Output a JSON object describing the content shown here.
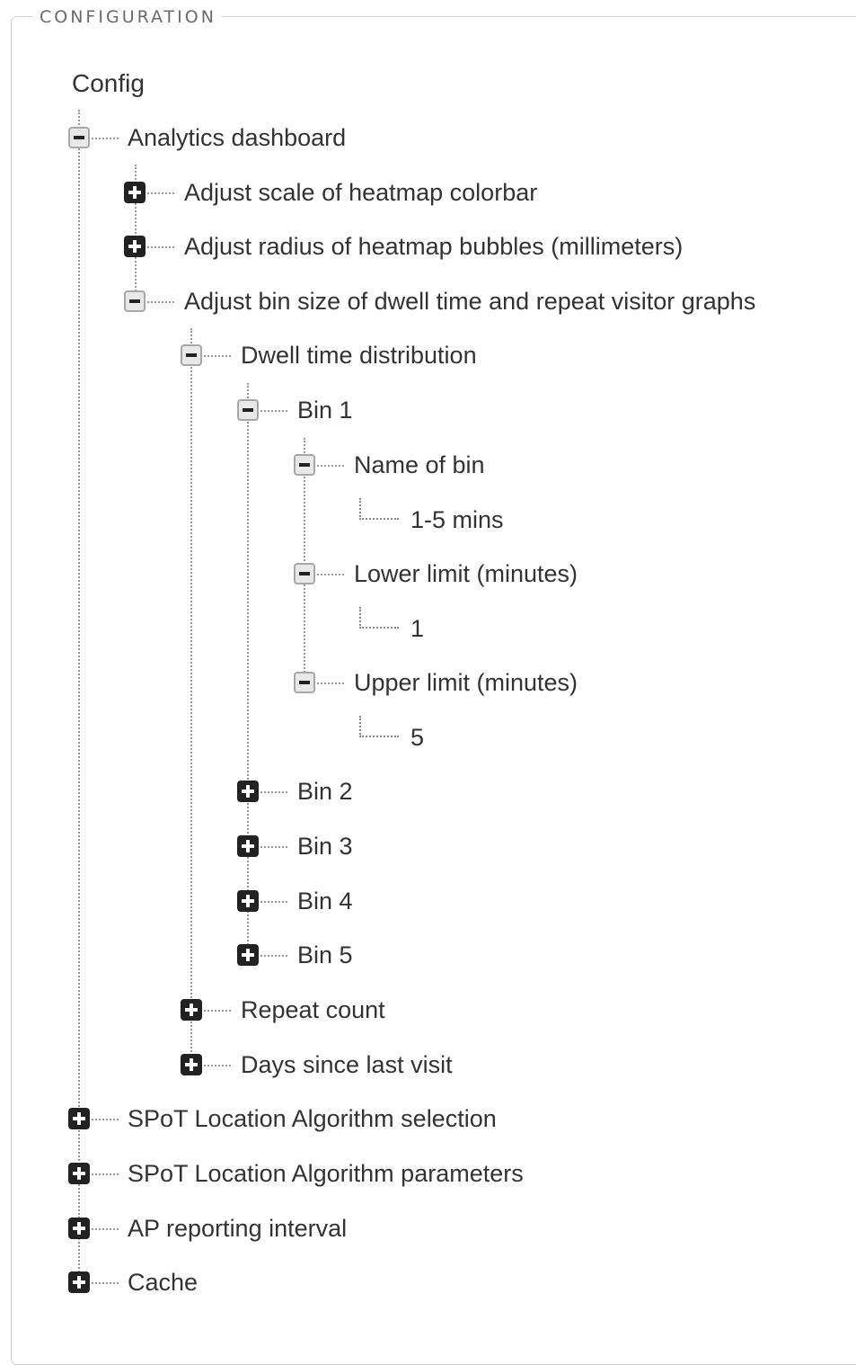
{
  "panel": {
    "legend": "CONFIGURATION",
    "root": "Config"
  },
  "tree": {
    "analytics_dashboard": "Analytics dashboard",
    "adjust_scale": "Adjust scale of heatmap colorbar",
    "adjust_radius": "Adjust radius of heatmap bubbles (millimeters)",
    "adjust_bin_size": "Adjust bin size of dwell time and repeat visitor graphs",
    "dwell_time_distribution": "Dwell time distribution",
    "bin1": "Bin 1",
    "name_of_bin": "Name of bin",
    "name_of_bin_value": "1-5 mins",
    "lower_limit": "Lower limit (minutes)",
    "lower_limit_value": "1",
    "upper_limit": "Upper limit (minutes)",
    "upper_limit_value": "5",
    "bin2": "Bin 2",
    "bin3": "Bin 3",
    "bin4": "Bin 4",
    "bin5": "Bin 5",
    "repeat_count": "Repeat count",
    "days_since_last_visit": "Days since last visit",
    "spot_algorithm_selection": "SPoT Location Algorithm selection",
    "spot_algorithm_parameters": "SPoT Location Algorithm parameters",
    "ap_reporting_interval": "AP reporting interval",
    "cache": "Cache"
  }
}
